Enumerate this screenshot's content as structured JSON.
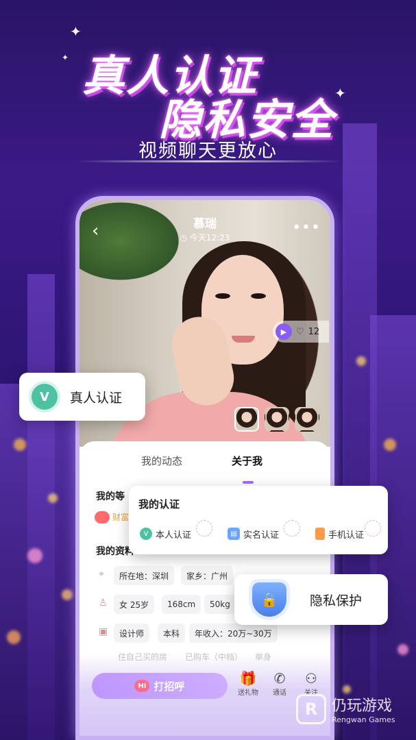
{
  "promo": {
    "headline_line1": "真人认证",
    "headline_line2": "隐私安全",
    "subline": "视频聊天更放心"
  },
  "profile": {
    "name": "慕瑞",
    "time": "今天12:23",
    "like_count": "12"
  },
  "tabs": [
    {
      "label": "我的动态",
      "active": false
    },
    {
      "label": "关于我",
      "active": true
    }
  ],
  "level": {
    "title": "我的等",
    "badge_text": "财富"
  },
  "info": {
    "title": "我的资料",
    "row1": [
      "所在地：深圳",
      "家乡：广州"
    ],
    "row2": [
      "女 25岁",
      "168cm",
      "50kg"
    ],
    "row3": [
      "设计师",
      "本科",
      "年收入：20万~30万"
    ],
    "row4": [
      "住自己买的房",
      "已购车（中档）",
      "单身"
    ]
  },
  "actions": {
    "greet_label": "打招呼",
    "hi_badge": "HI",
    "gift_label": "送礼物",
    "call_label": "通话",
    "follow_label": "关注"
  },
  "cards": {
    "verified_label": "真人认证",
    "cert_title": "我的认证",
    "cert_items": [
      {
        "label": "本人认证",
        "color": "#4cc2a2"
      },
      {
        "label": "实名认证",
        "color": "#6aa6ff"
      },
      {
        "label": "手机认证",
        "color": "#ff9a4a"
      }
    ],
    "privacy_label": "隐私保护"
  },
  "watermark": {
    "cn": "仍玩游戏",
    "en": "Rengwan Games"
  },
  "colors": {
    "accent": "#a56dff",
    "verified_green": "#4cc2a2",
    "shield_blue": "#4a7fe6"
  }
}
